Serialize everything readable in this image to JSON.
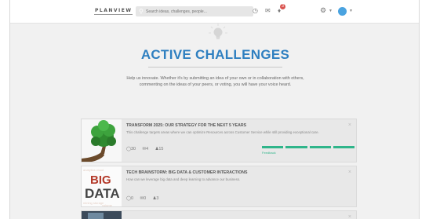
{
  "header": {
    "logo": "PLANVIEW",
    "search_placeholder": "Search ideas, challenges, people...",
    "notification_count": "3"
  },
  "page": {
    "title": "ACTIVE CHALLENGES",
    "intro": "Help us innovate. Whether it's by submitting an idea of your own or in collaboration with others, commenting on the ideas of your peers, or voting, you will have your voice heard."
  },
  "challenges": [
    {
      "title": "TRANSFORM 2025: OUR STRATEGY FOR THE NEXT 5 YEARS",
      "description": "This challenge targets areas where we can optimize Resources across Customer Service while still providing exceptional care.",
      "ideas": "30",
      "comments": "4",
      "people": "15",
      "progress": 1.0,
      "phase": "Feedback"
    },
    {
      "title": "TECH BRAINSTORM: BIG DATA & CUSTOMER INTERACTIONS",
      "description": "How can we leverage big data and deep learning to advance our business.",
      "ideas": "0",
      "comments": "0",
      "people": "3",
      "thumb_text": [
        "BIG",
        "DATA"
      ]
    },
    {
      "title": "",
      "description": ""
    }
  ],
  "colors": {
    "accent": "#2e7fc0",
    "progress": "#2fb58a",
    "badge": "#d9534f"
  }
}
